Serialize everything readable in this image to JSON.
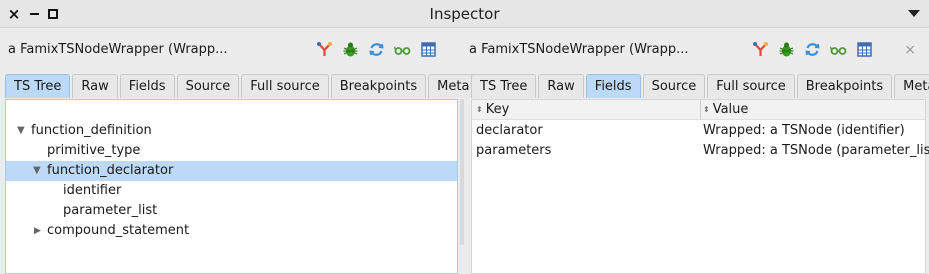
{
  "window": {
    "title": "Inspector",
    "close_glyph": "×",
    "minimize_icon": "minimize-icon",
    "maximize_icon": "maximize-icon",
    "menu_icon": "window-menu-icon"
  },
  "left": {
    "title": "a FamixTSNodeWrapper (Wrapp...",
    "toolbar_icons": [
      "fork-icon",
      "bug-icon",
      "refresh-icon",
      "glasses-icon",
      "grid-icon"
    ],
    "tabs": [
      "TS Tree",
      "Raw",
      "Fields",
      "Source",
      "Full source",
      "Breakpoints",
      "Meta"
    ],
    "active_tab": "TS Tree",
    "tree": [
      {
        "label": "function_definition",
        "twisty": "▼"
      },
      {
        "label": "primitive_type",
        "twisty": ""
      },
      {
        "label": "function_declarator",
        "twisty": "▼"
      },
      {
        "label": "identifier",
        "twisty": ""
      },
      {
        "label": "parameter_list",
        "twisty": ""
      },
      {
        "label": "compound_statement",
        "twisty": "▶"
      }
    ],
    "selected_tree_item": "function_declarator"
  },
  "right": {
    "title": "a FamixTSNodeWrapper (Wrapp...",
    "toolbar_icons": [
      "fork-icon",
      "bug-icon",
      "refresh-icon",
      "glasses-icon",
      "grid-icon"
    ],
    "close_glyph": "×",
    "tabs": [
      "TS Tree",
      "Raw",
      "Fields",
      "Source",
      "Full source",
      "Breakpoints",
      "Meta"
    ],
    "active_tab": "Fields",
    "columns": {
      "key": "Key",
      "value": "Value",
      "sort_glyph": "⬍"
    },
    "rows": [
      {
        "key": "declarator",
        "value": "Wrapped: a TSNode (identifier)"
      },
      {
        "key": "parameters",
        "value": "Wrapped: a TSNode (parameter_list)"
      }
    ]
  },
  "colors": {
    "selection": "#bcd9f5",
    "fork_icon": "#e8453c",
    "bug_icon": "#3a9a1f",
    "refresh_icon": "#3d8fd8",
    "glasses_icon": "#4f9a3a",
    "grid_icon": "#3d6fb0"
  }
}
